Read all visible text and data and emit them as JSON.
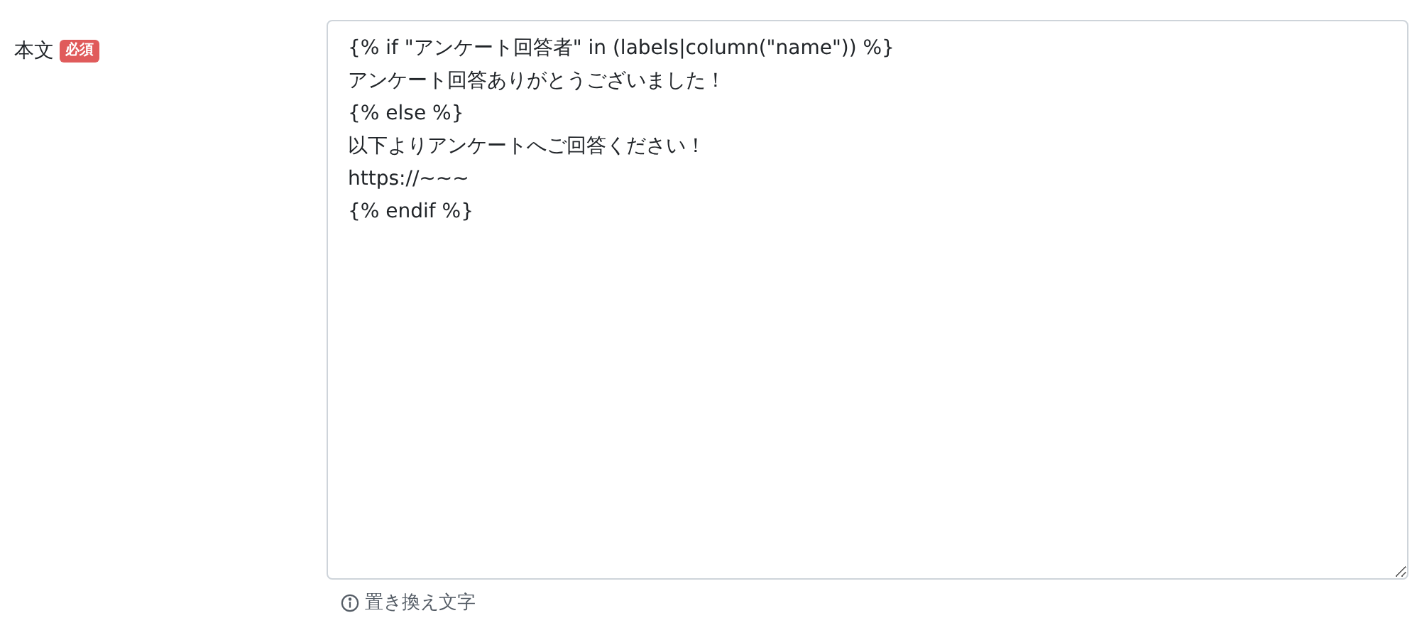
{
  "field": {
    "label": "本文",
    "required_badge": "必須",
    "value": "{% if \"アンケート回答者\" in (labels|column(\"name\")) %}\nアンケート回答ありがとうございました！\n{% else %}\n以下よりアンケートへご回答ください！\nhttps://~~~\n{% endif %}",
    "help_link": "置き換え文字"
  }
}
